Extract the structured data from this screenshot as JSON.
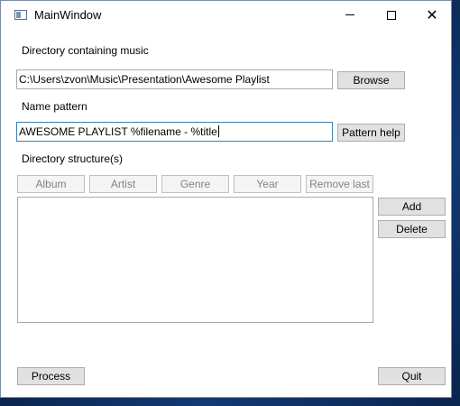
{
  "window": {
    "title": "MainWindow"
  },
  "directory": {
    "label": "Directory containing music",
    "value": "C:\\Users\\zvon\\Music\\Presentation\\Awesome Playlist",
    "browse_label": "Browse"
  },
  "name_pattern": {
    "label": "Name pattern",
    "value": "AWESOME PLAYLIST %filename - %title",
    "help_label": "Pattern help"
  },
  "structure": {
    "label": "Directory structure(s)",
    "tag_buttons": [
      "Album",
      "Artist",
      "Genre",
      "Year",
      "Remove last"
    ],
    "add_label": "Add",
    "delete_label": "Delete"
  },
  "footer": {
    "process_label": "Process",
    "quit_label": "Quit"
  }
}
